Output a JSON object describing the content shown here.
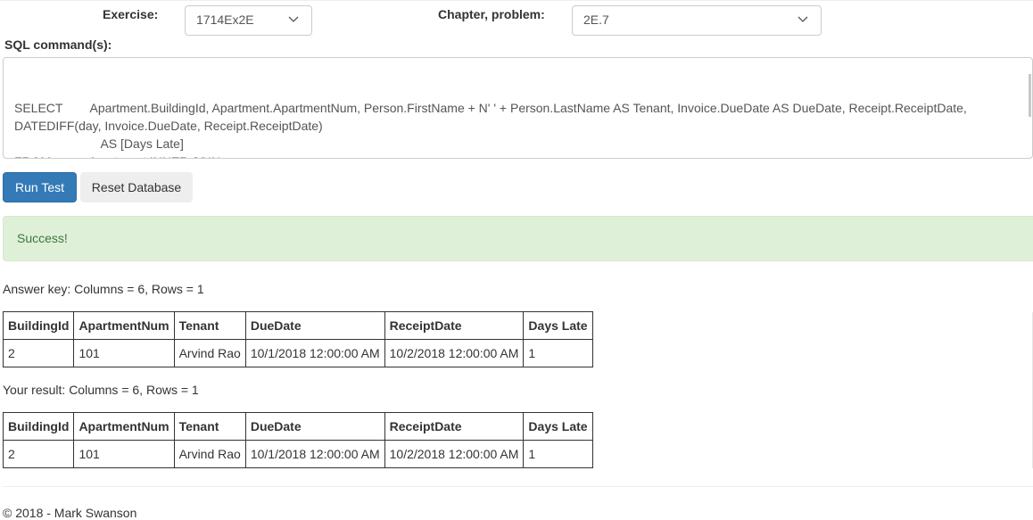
{
  "form": {
    "exercise_label": "Exercise:",
    "exercise_value": "1714Ex2E",
    "chapter_label": "Chapter, problem:",
    "chapter_value": "2E.7",
    "sql_label": "SQL command(s):",
    "sql_text": "SELECT        Apartment.BuildingId, Apartment.ApartmentNum, Person.FirstName + N' ' + Person.LastName AS Tenant, Invoice.DueDate AS DueDate, Receipt.ReceiptDate,\nDATEDIFF(day, Invoice.DueDate, Receipt.ReceiptDate)\n                         AS [Days Late]\nFROM           Apartment INNER JOIN\n                         Person ON Apartment.TenantId = Person.PersonId INNER JOIN\n                         Invoice ON Apartment.ApartmentId = Invoice.ApartmentId INNER JOIN"
  },
  "buttons": {
    "run_test": "Run Test",
    "reset_db": "Reset Database"
  },
  "alert": {
    "message": "Success!"
  },
  "answer_key": {
    "caption": "Answer key: Columns = 6, Rows = 1",
    "headers": [
      "BuildingId",
      "ApartmentNum",
      "Tenant",
      "DueDate",
      "ReceiptDate",
      "Days Late"
    ],
    "rows": [
      [
        "2",
        "101",
        "Arvind Rao",
        "10/1/2018 12:00:00 AM",
        "10/2/2018 12:00:00 AM",
        "1"
      ]
    ]
  },
  "your_result": {
    "caption": "Your result: Columns = 6, Rows = 1",
    "headers": [
      "BuildingId",
      "ApartmentNum",
      "Tenant",
      "DueDate",
      "ReceiptDate",
      "Days Late"
    ],
    "rows": [
      [
        "2",
        "101",
        "Arvind Rao",
        "10/1/2018 12:00:00 AM",
        "10/2/2018 12:00:00 AM",
        "1"
      ]
    ]
  },
  "footer": {
    "text": "© 2018 - Mark Swanson"
  },
  "icons": {
    "select_arrow": "chevron-down-icon"
  },
  "colors": {
    "primary_button": "#337ab7",
    "success_bg": "#dff0d8",
    "success_text": "#3c763d"
  }
}
